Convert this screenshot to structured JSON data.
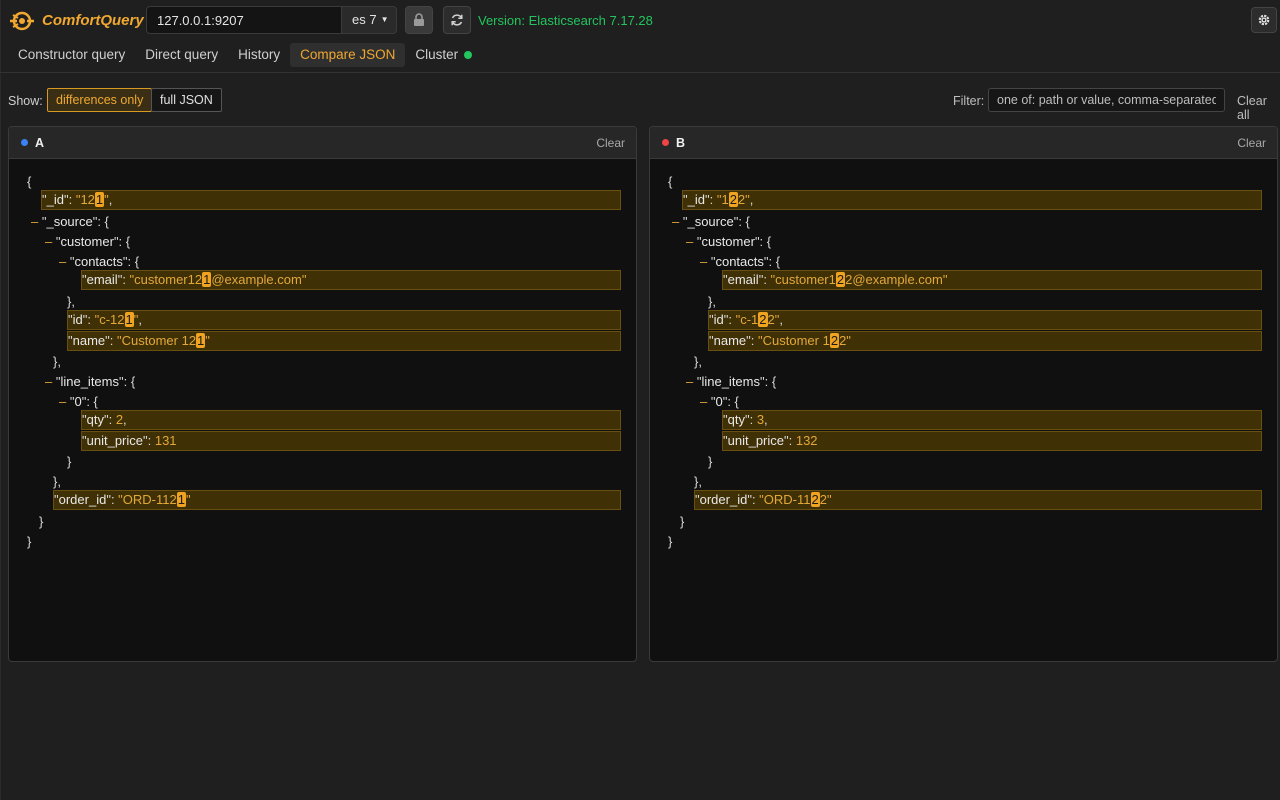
{
  "header": {
    "app_name": "ComfortQuery",
    "host": "127.0.0.1:9207",
    "es_version_select": "es 7",
    "version_text": "Version: Elasticsearch 7.17.28",
    "icons": {
      "lock": "lock-icon",
      "refresh": "refresh-icon",
      "settings": "gear-icon"
    }
  },
  "tabs": [
    {
      "label": "Constructor query"
    },
    {
      "label": "Direct query"
    },
    {
      "label": "History"
    },
    {
      "label": "Compare JSON",
      "active": true
    },
    {
      "label": "Cluster",
      "status_color": "#22c55e"
    }
  ],
  "toolbar": {
    "show_label": "Show:",
    "differences_only": "differences only",
    "full_json": "full JSON",
    "filter_label": "Filter:",
    "filter_placeholder": "one of: path or value, comma-separated",
    "clear_all": "Clear all"
  },
  "panels": {
    "a": {
      "title": "A",
      "dot_color": "#3b82f6",
      "clear": "Clear",
      "values": {
        "id": [
          "12",
          "1",
          ""
        ],
        "email": [
          "customer12",
          "1",
          "@example.com"
        ],
        "cid": [
          "c-12",
          "1",
          ""
        ],
        "name": [
          "Customer 12",
          "1",
          ""
        ],
        "qty": "2",
        "unit_price": "131",
        "order_id": [
          "ORD-112",
          "1",
          ""
        ]
      }
    },
    "b": {
      "title": "B",
      "dot_color": "#ef4444",
      "clear": "Clear",
      "values": {
        "id": [
          "1",
          "2",
          "2"
        ],
        "email": [
          "customer1",
          "2",
          "2@example.com"
        ],
        "cid": [
          "c-1",
          "2",
          "2"
        ],
        "name": [
          "Customer 1",
          "2",
          "2"
        ],
        "qty": "3",
        "unit_price": "132",
        "order_id": [
          "ORD-11",
          "2",
          "2"
        ]
      }
    }
  },
  "keys": {
    "id_root": "_id",
    "source": "_source",
    "customer": "customer",
    "contacts": "contacts",
    "email": "email",
    "id": "id",
    "name": "name",
    "line_items": "line_items",
    "zero": "0",
    "qty": "qty",
    "unit_price": "unit_price",
    "order_id": "order_id"
  },
  "colors": {
    "accent": "#f0a830",
    "success": "#22c55e",
    "diff_bg": "#403006",
    "diff_mark": "#f0a320"
  }
}
